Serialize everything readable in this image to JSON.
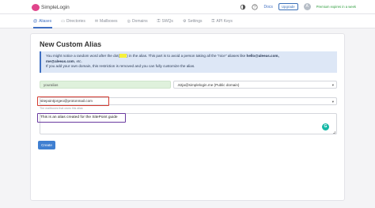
{
  "brand": {
    "name": "SimpleLogin"
  },
  "topbar": {
    "docs_label": "Docs",
    "upgrade_label": "Upgrade",
    "avatar_initial": "A",
    "premium_text": "Premium expires in a week"
  },
  "nav": {
    "items": [
      {
        "label": "Aliases",
        "icon": "at-icon"
      },
      {
        "label": "Directories",
        "icon": "folder-icon"
      },
      {
        "label": "Mailboxes",
        "icon": "inbox-icon"
      },
      {
        "label": "Domains",
        "icon": "globe-icon"
      },
      {
        "label": "SWQs",
        "icon": "key-icon"
      },
      {
        "label": "Settings",
        "icon": "gear-icon"
      },
      {
        "label": "API Keys",
        "icon": "key-icon"
      }
    ],
    "active_index": 0
  },
  "page": {
    "title": "New Custom Alias",
    "info": {
      "line1_a": "You might notice a random word after the dot(",
      "line1_b": ") in the alias. This part is to avoid a person taking all the \"nice\" aliases like",
      "line1_c": "hello@aleeas.com,",
      "line2_a": "me@aleeas.com",
      "line2_b": ", etc.",
      "line3": "If you add your own domain, this restriction is removed and you can fully customize the alias."
    },
    "prefix_value": "youralias",
    "suffix_value": ".82ja@simplelogin.me (Public domain)",
    "mailbox_value": "sitepointjorgeo@protonmail.com",
    "mailbox_help": "The mailboxes that owns this alias",
    "note_value": "This is an alias created for the SitePoint guide",
    "create_label": "Create"
  },
  "colors": {
    "accent": "#3f6fc2",
    "mailbox_highlight": "#d43a2f",
    "note_highlight": "#6a3aa0",
    "prefix_bg": "#dff1dc",
    "info_bg": "#dde7f6"
  }
}
